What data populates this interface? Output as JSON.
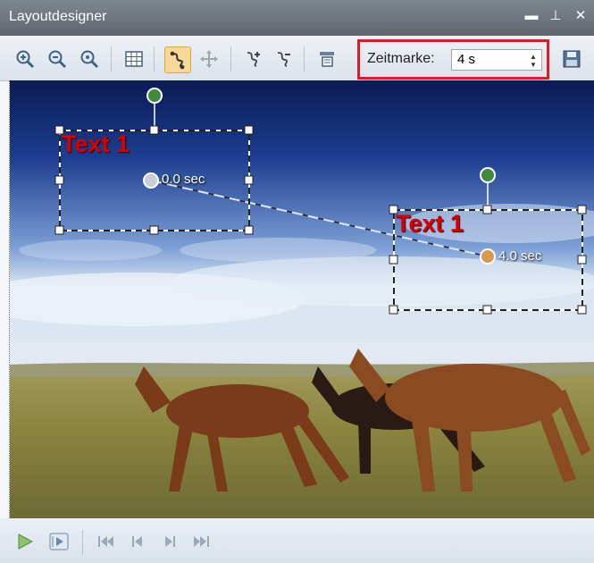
{
  "window": {
    "title": "Layoutdesigner"
  },
  "window_controls": [
    "minimize-icon",
    "pin-icon",
    "close-icon"
  ],
  "toolbar": {
    "zeitmarke_label": "Zeitmarke:",
    "zeitmarke_value": "4 s",
    "icons": [
      "zoom-in-icon",
      "zoom-out-icon",
      "zoom-reset-icon",
      "grid-icon",
      "motion-path-icon",
      "move-icon",
      "add-keyframe-icon",
      "remove-keyframe-icon",
      "align-icon",
      "save-icon"
    ]
  },
  "canvas": {
    "object_start": {
      "label": "Text 1",
      "time": "0.0 sec"
    },
    "object_end": {
      "label": "Text 1",
      "time": "4.0 sec"
    }
  },
  "playback": {
    "icons": [
      "play-icon",
      "play-frame-icon",
      "skip-start-icon",
      "step-back-icon",
      "step-forward-icon",
      "skip-end-icon"
    ]
  },
  "colors": {
    "highlight": "#d91f25",
    "text_object": "#d50000"
  }
}
